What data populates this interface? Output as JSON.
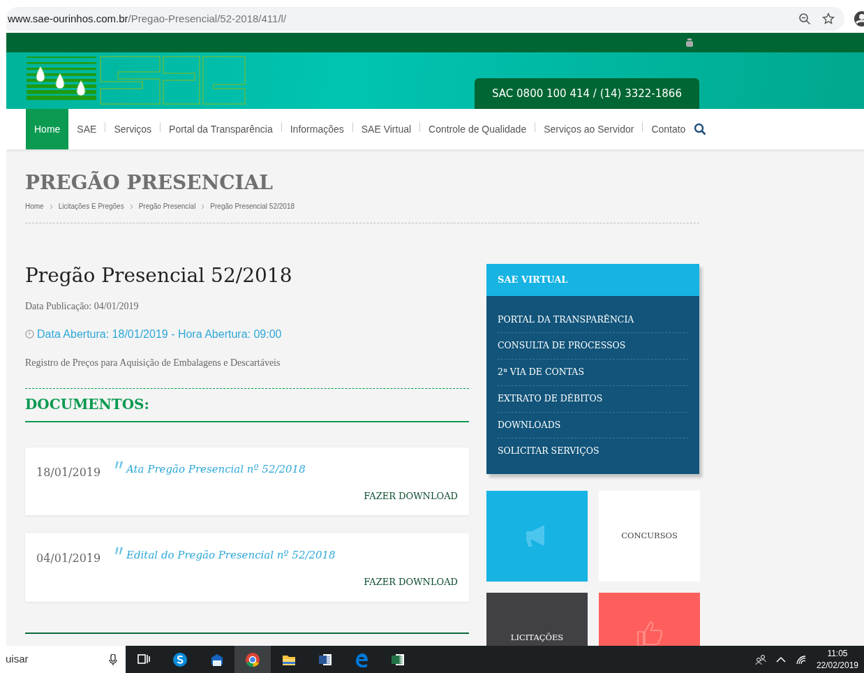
{
  "browser": {
    "url_host": "www.sae-ourinhos.com.br",
    "url_path": "/Pregao-Presencial/52-2018/411/l/"
  },
  "header": {
    "sac": "SAC 0800 100 414 / (14) 3322-1866"
  },
  "nav": [
    {
      "label": "Home",
      "selected": true
    },
    {
      "label": "SAE",
      "selected": false
    },
    {
      "label": "Serviços",
      "selected": false
    },
    {
      "label": "Portal da Transparência",
      "selected": false
    },
    {
      "label": "Informações",
      "selected": false
    },
    {
      "label": "SAE Virtual",
      "selected": false
    },
    {
      "label": "Controle de Qualidade",
      "selected": false
    },
    {
      "label": "Serviços ao Servidor",
      "selected": false
    },
    {
      "label": "Contato",
      "selected": false
    }
  ],
  "page_title": "PREGÃO PRESENCIAL",
  "breadcrumb": [
    "Home",
    "Licitações E Pregões",
    "Pregão Presencial",
    "Pregão Presencial 52/2018"
  ],
  "article": {
    "title": "Pregão Presencial 52/2018",
    "published": "Data Publicação: 04/01/2019",
    "opening": "Data Abertura: 18/01/2019 - Hora Abertura: 09:00",
    "description": "Registro de Preços para Aquisição de Embalagens e Descartáveis"
  },
  "documents": {
    "heading": "DOCUMENTOS:",
    "items": [
      {
        "date": "18/01/2019",
        "title": "Ata Pregão Presencial nº 52/2018",
        "action": "FAZER DOWNLOAD"
      },
      {
        "date": "04/01/2019",
        "title": "Edital do Pregão Presencial nº 52/2018",
        "action": "FAZER DOWNLOAD"
      }
    ]
  },
  "sidebar": {
    "title": "SAE VIRTUAL",
    "items": [
      "PORTAL DA TRANSPARÊNCIA",
      "CONSULTA DE PROCESSOS",
      "2ª VIA DE CONTAS",
      "EXTRATO DE DÉBITOS",
      "DOWNLOADS",
      "SOLICITAR SERVIÇOS"
    ]
  },
  "tiles": [
    {
      "kind": "megaphone",
      "color": "#16b3e3"
    },
    {
      "kind": "label",
      "label": "CONCURSOS",
      "color": "#ffffff"
    },
    {
      "kind": "label",
      "label": "LICITAÇÕES",
      "color": "#414045"
    },
    {
      "kind": "thumbsup",
      "color": "#fe5f5c"
    }
  ],
  "taskbar": {
    "search": "uisar",
    "apps": [
      {
        "kind": "taskview",
        "selected": false
      },
      {
        "kind": "skype",
        "selected": false
      },
      {
        "kind": "mail",
        "selected": false
      },
      {
        "kind": "chrome",
        "selected": true
      },
      {
        "kind": "folder",
        "selected": false
      },
      {
        "kind": "word",
        "selected": false
      },
      {
        "kind": "edge",
        "selected": false
      },
      {
        "kind": "excel",
        "selected": false
      }
    ],
    "time": "11:05",
    "date": "22/02/2019"
  }
}
